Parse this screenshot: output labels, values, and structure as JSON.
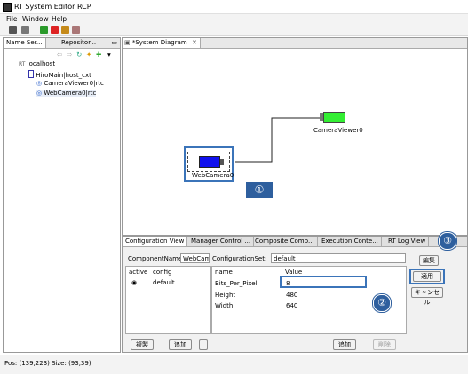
{
  "window": {
    "title": "RT System Editor RCP"
  },
  "menu": {
    "file": "File",
    "window": "Window",
    "help": "Help"
  },
  "left_tabs": {
    "name_server": "Name Ser...",
    "repository": "Repositor..."
  },
  "tree": {
    "root": "localhost",
    "context": "HiroMain|host_cxt",
    "items": [
      "CameraViewer0|rtc",
      "WebCamera0|rtc"
    ]
  },
  "diagram": {
    "tab_label": "*System Diagram",
    "components": {
      "camera_viewer": "CameraViewer0",
      "web_camera": "WebCamera0"
    },
    "colors": {
      "camera_viewer": "#33ee33",
      "web_camera": "#1111ee"
    }
  },
  "bottom_tabs": [
    "Configuration View",
    "Manager Control ...",
    "Composite Comp...",
    "Execution Conte...",
    "RT Log View"
  ],
  "config": {
    "component_name_label": "ComponentName:",
    "component_name_value": "WebCamera0",
    "config_set_label": "ConfigurationSet:",
    "config_set_value": "default",
    "sets_headers": {
      "active": "active",
      "config": "config"
    },
    "sets": [
      {
        "name": "default"
      }
    ],
    "params_headers": {
      "name": "name",
      "value": "Value"
    },
    "params": [
      {
        "name": "Bits_Per_Pixel",
        "value": "8"
      },
      {
        "name": "Height",
        "value": "480"
      },
      {
        "name": "Width",
        "value": "640"
      }
    ],
    "buttons": {
      "edit": "編集",
      "apply": "適用",
      "cancel": "キャンセル",
      "copy": "複製",
      "add_left": "追加",
      "add_right": "追加",
      "delete": "削除"
    }
  },
  "callouts": {
    "one": "①",
    "two": "②",
    "three": "③"
  },
  "status": {
    "text": "Pos: (139,223) Size: (93,39)"
  }
}
